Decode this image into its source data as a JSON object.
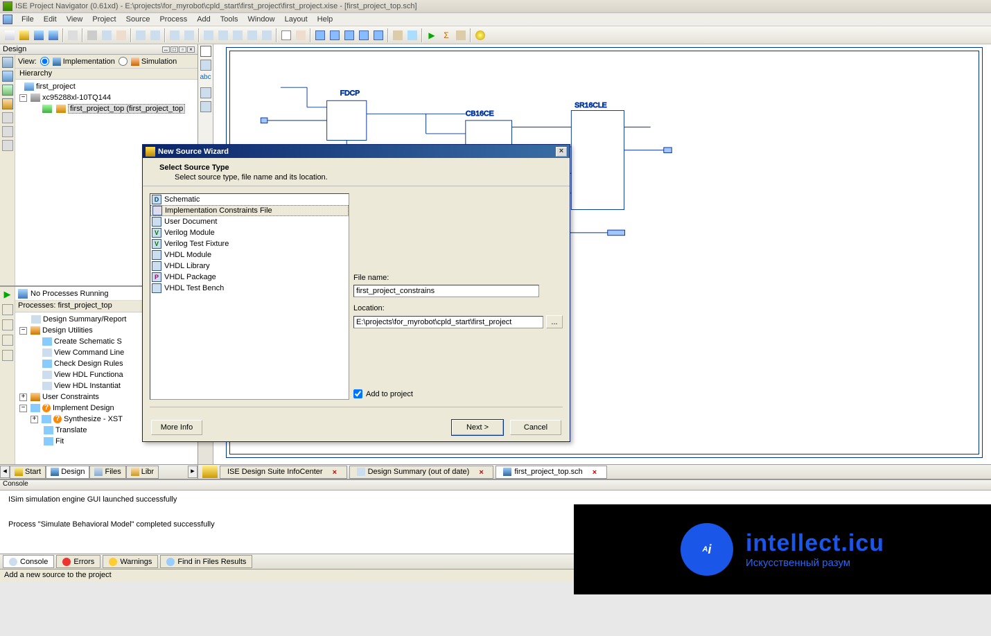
{
  "title": "ISE Project Navigator (0.61xd) - E:\\projects\\for_myrobot\\cpld_start\\first_project\\first_project.xise - [first_project_top.sch]",
  "menus": [
    "File",
    "Edit",
    "View",
    "Project",
    "Source",
    "Process",
    "Add",
    "Tools",
    "Window",
    "Layout",
    "Help"
  ],
  "design_panel": {
    "title": "Design",
    "view_label": "View:",
    "impl_label": "Implementation",
    "sim_label": "Simulation",
    "hierarchy_label": "Hierarchy",
    "tree": {
      "project": "first_project",
      "device": "xc95288xl-10TQ144",
      "top": "first_project_top (first_project_top"
    }
  },
  "processes": {
    "no_running": "No Processes Running",
    "label": "Processes: first_project_top",
    "items": [
      "Design Summary/Report",
      "Design Utilities",
      "Create Schematic S",
      "View Command Line",
      "Check Design Rules",
      "View HDL Functiona",
      "View HDL Instantiat",
      "User Constraints",
      "Implement Design",
      "Synthesize - XST",
      "Translate",
      "Fit"
    ]
  },
  "left_tabs": [
    "Start",
    "Design",
    "Files",
    "Libr"
  ],
  "doc_tabs": [
    "ISE Design Suite InfoCenter",
    "Design Summary (out of date)",
    "first_project_top.sch"
  ],
  "console": {
    "title": "Console",
    "line1": "ISim simulation engine GUI launched successfully",
    "line2": "Process \"Simulate Behavioral Model\" completed successfully"
  },
  "bottom_tabs": [
    "Console",
    "Errors",
    "Warnings",
    "Find in Files Results"
  ],
  "statusbar": "Add a new source to the project",
  "wizard": {
    "title": "New Source Wizard",
    "head1": "Select Source Type",
    "head2": "Select source type, file name and its location.",
    "items": [
      "Schematic",
      "Implementation Constraints File",
      "User Document",
      "Verilog Module",
      "Verilog Test Fixture",
      "VHDL Module",
      "VHDL Library",
      "VHDL Package",
      "VHDL Test Bench"
    ],
    "item_codes": [
      "D",
      "",
      "",
      "V",
      "V",
      "",
      "",
      "P",
      ""
    ],
    "filename_label": "File name:",
    "filename": "first_project_constrains",
    "location_label": "Location:",
    "location": "E:\\projects\\for_myrobot\\cpld_start\\first_project",
    "browse": "...",
    "add_label": "Add to project",
    "moreinfo": "More Info",
    "next": "Next >",
    "cancel": "Cancel"
  },
  "schematic_labels": {
    "fdcp": "FDCP",
    "cb16ce": "CB16CE",
    "sr16cle": "SR16CLE"
  },
  "overlay": {
    "logo": "A",
    "dot": "i",
    "title": "intellect.icu",
    "sub": "Искусственный разум"
  }
}
